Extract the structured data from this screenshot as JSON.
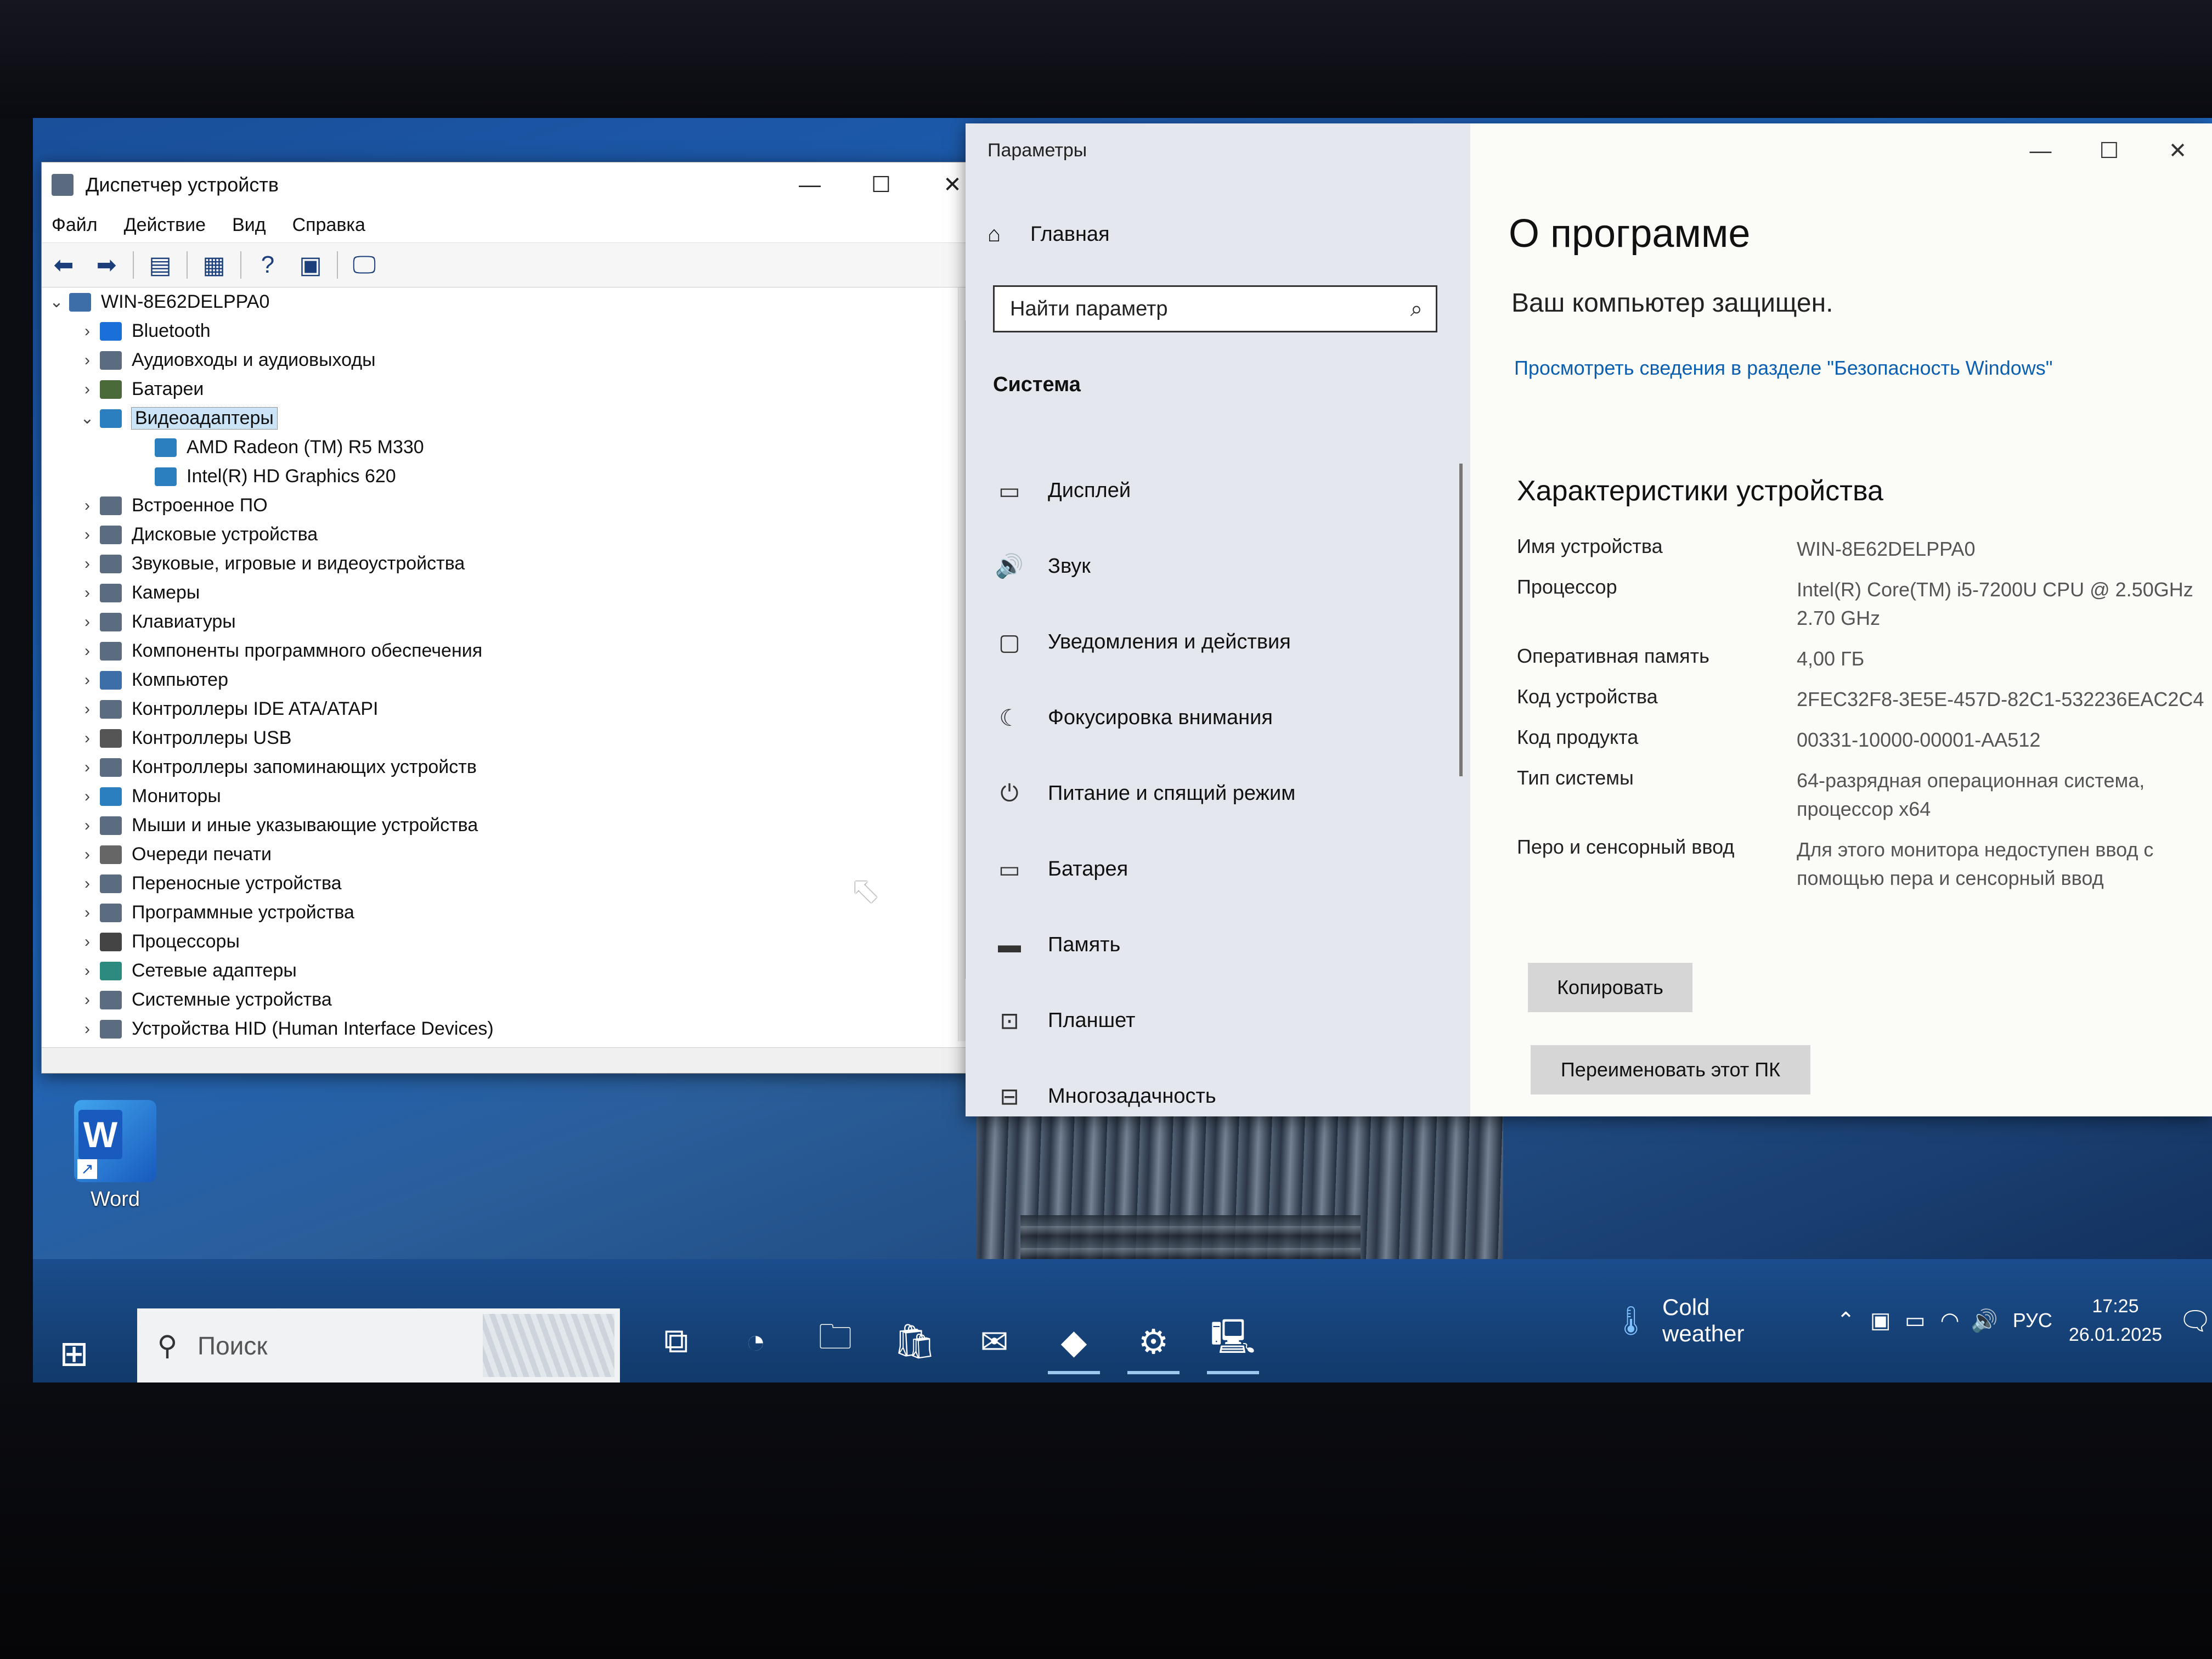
{
  "device_manager": {
    "title": "Диспетчер устройств",
    "menu": [
      "Файл",
      "Действие",
      "Вид",
      "Справка"
    ],
    "tree": [
      {
        "label": "WIN-8E62DELPPA0",
        "level": 0,
        "caret": "expanded",
        "icon": "computer-icon"
      },
      {
        "label": "Bluetooth",
        "level": 1,
        "caret": "collapsed",
        "icon": "bluetooth-icon"
      },
      {
        "label": "Аудиовходы и аудиовыходы",
        "level": 1,
        "caret": "collapsed",
        "icon": "speaker-icon"
      },
      {
        "label": "Батареи",
        "level": 1,
        "caret": "collapsed",
        "icon": "battery-icon"
      },
      {
        "label": "Видеоадаптеры",
        "level": 1,
        "caret": "expanded",
        "icon": "display-adapter-icon",
        "selected": true
      },
      {
        "label": "AMD Radeon (TM) R5 M330",
        "level": 2,
        "caret": "none",
        "icon": "display-adapter-icon"
      },
      {
        "label": "Intel(R) HD Graphics 620",
        "level": 2,
        "caret": "none",
        "icon": "display-adapter-icon"
      },
      {
        "label": "Встроенное ПО",
        "level": 1,
        "caret": "collapsed",
        "icon": "firmware-icon"
      },
      {
        "label": "Дисковые устройства",
        "level": 1,
        "caret": "collapsed",
        "icon": "disk-icon"
      },
      {
        "label": "Звуковые, игровые и видеоустройства",
        "level": 1,
        "caret": "collapsed",
        "icon": "sound-icon"
      },
      {
        "label": "Камеры",
        "level": 1,
        "caret": "collapsed",
        "icon": "camera-icon"
      },
      {
        "label": "Клавиатуры",
        "level": 1,
        "caret": "collapsed",
        "icon": "keyboard-icon"
      },
      {
        "label": "Компоненты программного обеспечения",
        "level": 1,
        "caret": "collapsed",
        "icon": "software-component-icon"
      },
      {
        "label": "Компьютер",
        "level": 1,
        "caret": "collapsed",
        "icon": "computer-icon"
      },
      {
        "label": "Контроллеры IDE ATA/ATAPI",
        "level": 1,
        "caret": "collapsed",
        "icon": "ide-controller-icon"
      },
      {
        "label": "Контроллеры USB",
        "level": 1,
        "caret": "collapsed",
        "icon": "usb-icon"
      },
      {
        "label": "Контроллеры запоминающих устройств",
        "level": 1,
        "caret": "collapsed",
        "icon": "storage-controller-icon"
      },
      {
        "label": "Мониторы",
        "level": 1,
        "caret": "collapsed",
        "icon": "monitor-icon"
      },
      {
        "label": "Мыши и иные указывающие устройства",
        "level": 1,
        "caret": "collapsed",
        "icon": "mouse-icon"
      },
      {
        "label": "Очереди печати",
        "level": 1,
        "caret": "collapsed",
        "icon": "printer-icon"
      },
      {
        "label": "Переносные устройства",
        "level": 1,
        "caret": "collapsed",
        "icon": "portable-device-icon"
      },
      {
        "label": "Программные устройства",
        "level": 1,
        "caret": "collapsed",
        "icon": "software-device-icon"
      },
      {
        "label": "Процессоры",
        "level": 1,
        "caret": "collapsed",
        "icon": "processor-icon"
      },
      {
        "label": "Сетевые адаптеры",
        "level": 1,
        "caret": "collapsed",
        "icon": "network-adapter-icon"
      },
      {
        "label": "Системные устройства",
        "level": 1,
        "caret": "collapsed",
        "icon": "system-device-icon"
      },
      {
        "label": "Устройства HID (Human Interface Devices)",
        "level": 1,
        "caret": "collapsed",
        "icon": "hid-icon"
      }
    ]
  },
  "settings": {
    "title": "Параметры",
    "home": "Главная",
    "search_placeholder": "Найти параметр",
    "section": "Система",
    "nav": [
      {
        "label": "Дисплей",
        "icon": "display-icon",
        "glyph": "▭"
      },
      {
        "label": "Звук",
        "icon": "volume-icon",
        "glyph": "🔊"
      },
      {
        "label": "Уведомления и действия",
        "icon": "notification-icon",
        "glyph": "▢"
      },
      {
        "label": "Фокусировка внимания",
        "icon": "moon-icon",
        "glyph": "☾"
      },
      {
        "label": "Питание и спящий режим",
        "icon": "power-icon",
        "glyph": "⏻"
      },
      {
        "label": "Батарея",
        "icon": "battery-icon",
        "glyph": "▭"
      },
      {
        "label": "Память",
        "icon": "storage-icon",
        "glyph": "▬"
      },
      {
        "label": "Планшет",
        "icon": "tablet-icon",
        "glyph": "⊡"
      },
      {
        "label": "Многозадачность",
        "icon": "multitasking-icon",
        "glyph": "⊟"
      }
    ],
    "heading": "О программе",
    "protected": "Ваш компьютер защищен.",
    "security_link": "Просмотреть сведения в разделе \"Безопасность Windows\"",
    "specs_heading": "Характеристики устройства",
    "specs": [
      {
        "key": "Имя устройства",
        "value": "WIN-8E62DELPPA0"
      },
      {
        "key": "Процессор",
        "value": "Intel(R) Core(TM) i5-7200U CPU @ 2.50GHz   2.70 GHz"
      },
      {
        "key": "Оперативная память",
        "value": "4,00 ГБ"
      },
      {
        "key": "Код устройства",
        "value": "2FEC32F8-3E5E-457D-82C1-532236EAC2C4"
      },
      {
        "key": "Код продукта",
        "value": "00331-10000-00001-AA512"
      },
      {
        "key": "Тип системы",
        "value": "64-разрядная операционная система, процессор x64"
      },
      {
        "key": "Перо и сенсорный ввод",
        "value": "Для этого монитора недоступен ввод с помощью пера и сенсорный ввод"
      }
    ],
    "copy_button": "Копировать",
    "rename_button": "Переименовать этот ПК"
  },
  "desktop": {
    "icons": [
      {
        "label": "Word",
        "icon": "word-icon"
      }
    ]
  },
  "taskbar": {
    "search_placeholder": "Поиск",
    "apps": [
      {
        "name": "task-view",
        "icon": "task-view-icon",
        "glyph": "⧉",
        "running": false
      },
      {
        "name": "edge",
        "icon": "edge-icon",
        "glyph": "◔",
        "running": false
      },
      {
        "name": "file-explorer",
        "icon": "folder-icon",
        "glyph": "🗀",
        "running": false
      },
      {
        "name": "store",
        "icon": "store-icon",
        "glyph": "🛍",
        "running": false
      },
      {
        "name": "mail",
        "icon": "mail-icon",
        "glyph": "✉",
        "running": false
      },
      {
        "name": "anydesk",
        "icon": "anydesk-icon",
        "glyph": "◆",
        "running": true
      },
      {
        "name": "settings",
        "icon": "gear-icon",
        "glyph": "⚙",
        "running": true
      },
      {
        "name": "device-manager",
        "icon": "device-manager-icon",
        "glyph": "🖳",
        "running": true
      }
    ],
    "weather": "Cold weather",
    "language": "РУС",
    "time": "17:25",
    "date": "26.01.2025"
  }
}
